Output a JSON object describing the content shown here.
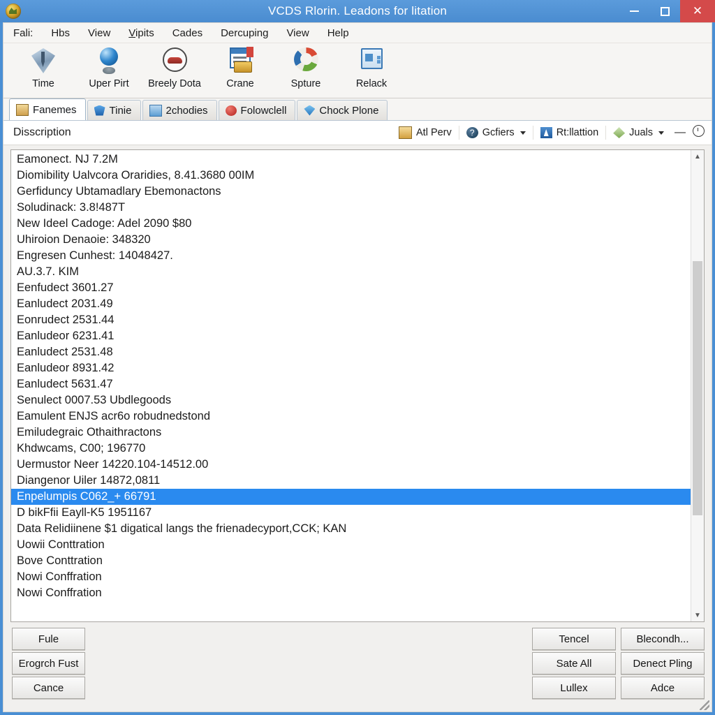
{
  "window": {
    "title": "VCDS Rlorin. Leadons for litation",
    "app_icon": "app-globe-icon",
    "minimize_label": "–",
    "maximize_label": "□",
    "close_label": "✕"
  },
  "menu": {
    "items": [
      {
        "label": "Fali:"
      },
      {
        "label": "Hbs"
      },
      {
        "label": "View"
      },
      {
        "label": "Vipits"
      },
      {
        "label": "Cades"
      },
      {
        "label": "Dercuping"
      },
      {
        "label": "View"
      },
      {
        "label": "Help"
      }
    ]
  },
  "toolbar": {
    "buttons": [
      {
        "label": "Time",
        "icon": "diamond-arrow-icon"
      },
      {
        "label": "Uper Pirt",
        "icon": "globe-pin-icon"
      },
      {
        "label": "Breely Dota",
        "icon": "car-circle-icon"
      },
      {
        "label": "Crane",
        "icon": "document-money-icon"
      },
      {
        "label": "Spture",
        "icon": "recycle-globe-icon"
      },
      {
        "label": "Relack",
        "icon": "folder-card-icon"
      }
    ]
  },
  "tabs": [
    {
      "label": "Fanemes",
      "icon": "book-icon",
      "active": true
    },
    {
      "label": "Tinie",
      "icon": "shield-icon",
      "active": false
    },
    {
      "label": "2chodies",
      "icon": "case-icon",
      "active": false
    },
    {
      "label": "Folowclell",
      "icon": "alert-icon",
      "active": false
    },
    {
      "label": "Chock Plone",
      "icon": "gem-icon",
      "active": false
    }
  ],
  "command_row": {
    "column_header": "Disscription",
    "buttons": [
      {
        "label": "Atl Perv",
        "icon": "save-icon",
        "has_caret": false
      },
      {
        "label": "Gcfiers",
        "icon": "help-icon",
        "has_caret": true
      },
      {
        "label": "Rt:llattion",
        "icon": "blue-person-icon",
        "has_caret": false
      },
      {
        "label": "Juals",
        "icon": "leaf-icon",
        "has_caret": true
      }
    ],
    "minimize_glyph": "—",
    "clock_glyph": "clock-icon"
  },
  "list": {
    "selected_index": 20,
    "rows": [
      "Eamonect. NJ 7.2M",
      "Diomibility Ualvcora Oraridies, 8.41.3680 00IM",
      "Gerfiduncy Ubtamadlary Ebemonactons",
      "Soludinack: 3.8!487T",
      "New Ideel Cadoge: Adel 2090 $80",
      "Uhiroion Denaoie: 348320",
      "Engresen Cunhest: 14048427.",
      "AU.3.7. KIM",
      "Eenfudect 3601.27",
      "Eanludect 2031.49",
      "Eonrudect 2531.44",
      "Eanludeor 6231.41",
      "Eanludect 2531.48",
      "Eanludeor 8931.42",
      "Eanludect 5631.47",
      "Senulect 0007.53 Ubdlegoods",
      "Eamulent ENJS acr6o robudnedstond",
      "Emiludegraic Othaithractons",
      "Khdwcams, C00; 196770",
      "Uermustor Neer 14220.104-14512.00",
      "Diangenor Uiler 14872,0811",
      "Enpelumpis C062_+ 66791",
      "D bikFfii Eayll-K5 1951167",
      "Data Relidiinene $1 digatical langs the frienadecyport,CCK; KAN",
      "Uowii Conttration",
      "Bove Conttration",
      "Nowi Conffration",
      "Nowi Conffration"
    ],
    "scrollbar": {
      "up_arrow": "▲",
      "down_arrow": "▼"
    }
  },
  "footer": {
    "left_buttons": [
      {
        "label": "Fule"
      },
      {
        "label": "Erogrch Fust"
      },
      {
        "label": "Cance"
      }
    ],
    "right_buttons": [
      {
        "label": "Tencel"
      },
      {
        "label": "Blecondh..."
      },
      {
        "label": "Sate All"
      },
      {
        "label": "Denect Pling"
      },
      {
        "label": "Lullex"
      },
      {
        "label": "Adce"
      }
    ]
  },
  "colors": {
    "window_frame": "#4a8fd4",
    "title_text": "#ffffff",
    "close_button": "#d44a4a",
    "selection": "#2a8aef",
    "client_bg": "#f1f0ee",
    "list_bg": "#ffffff"
  }
}
